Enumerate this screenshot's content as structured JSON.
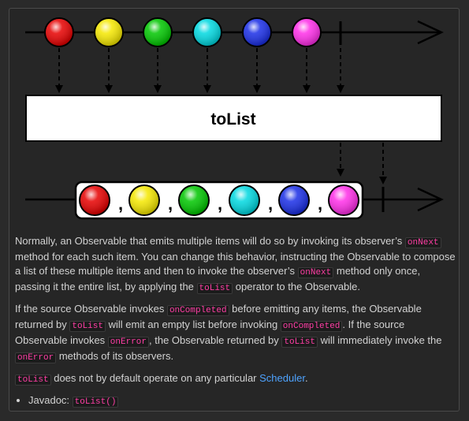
{
  "diagram": {
    "operator_label": "toList",
    "marble_colors": [
      "#e60000",
      "#f5e800",
      "#00c600",
      "#00d8e0",
      "#1a2ee6",
      "#ff2ee8"
    ],
    "separator": ","
  },
  "description": {
    "p1": {
      "t1": "Normally, an Observable that emits multiple items will do so by invoking its observer’s ",
      "c1": "onNext",
      "t2": " method for each such item. You can change this behavior, instructing the Observable to compose a list of these multiple items and then to invoke the observer’s ",
      "c2": "onNext",
      "t3": " method only once, passing it the entire list, by applying the ",
      "c3": "toList",
      "t4": " operator to the Observable."
    },
    "p2": {
      "t1": "If the source Observable invokes ",
      "c1": "onCompleted",
      "t2": " before emitting any items, the Observable returned by ",
      "c2": "toList",
      "t3": " will emit an empty list before invoking ",
      "c3": "onCompleted",
      "t4": ". If the source Observable invokes ",
      "c4": "onError",
      "t5": ", the Observable returned by ",
      "c5": "toList",
      "t6": " will immediately invoke the ",
      "c6": "onError",
      "t7": " methods of its observers."
    },
    "p3": {
      "c1": "toList",
      "t1": " does not by default operate on any particular ",
      "link": "Scheduler",
      "t2": "."
    },
    "list": {
      "label": "Javadoc: ",
      "code": "toList()"
    }
  }
}
